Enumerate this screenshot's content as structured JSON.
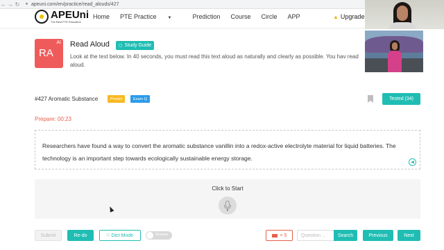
{
  "browser": {
    "url": "apeuni.com/en/practice/read_alouds/427"
  },
  "brand": {
    "name": "APEUni",
    "tagline": "The Best PTE Education"
  },
  "nav": {
    "items": [
      "Home",
      "PTE Practice",
      "Prediction",
      "Course",
      "Circle",
      "APP"
    ],
    "upgrade_label": "Upgrade V"
  },
  "header": {
    "badge_text": "RA",
    "badge_ai": "AI",
    "title": "Read Aloud",
    "guide_label": "Study Guide",
    "instructions": "Look at the text below. In 40 seconds, you must read this text aloud as naturally and clearly as possible. You hav read aloud."
  },
  "question": {
    "number_label": "#427 Aromatic Substance",
    "tags": [
      "Predict",
      "Exam Q"
    ],
    "tested_label": "Tested (34)",
    "prepare_label": "Prepare: 00:23",
    "passage": "Researchers have found a way to convert the aromatic substance vanillin into a redox-active electrolyte material for liquid batteries. The technology is an important step towards ecologically sustainable energy storage."
  },
  "recorder": {
    "start_label": "Click to Start"
  },
  "controls": {
    "submit_label": "Submit",
    "redo_label": "Re-do",
    "dict_label": "Dict Mode",
    "answer_toggle_label": "Answer",
    "answer_toggle_on": false,
    "ticket_label": "× 5",
    "search_placeholder": "Question ...",
    "search_label": "Search",
    "previous_label": "Previous",
    "next_label": "Next"
  },
  "colors": {
    "accent": "#20bdb3",
    "danger": "#e85e4a",
    "predict": "#f7b924",
    "exam": "#2c9be8",
    "badge": "#ef5b5b"
  }
}
